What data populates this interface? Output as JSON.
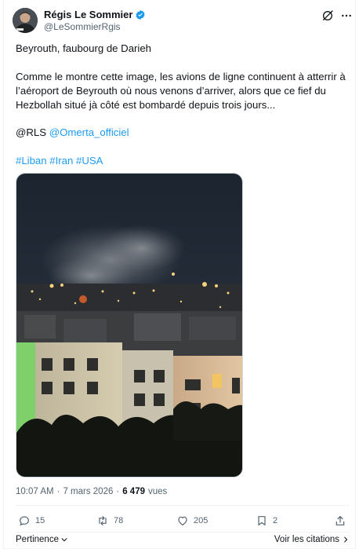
{
  "author": {
    "display_name": "Régis Le Sommier",
    "handle": "@LeSommierRgis"
  },
  "tweet": {
    "paragraph1": "Beyrouth, faubourg de Darieh",
    "paragraph2": "Comme le montre cette image, les avions de ligne continuent à atterrir à l’aéroport de Beyrouth où nous venons d’arriver, alors que ce fief du Hezbollah situé jà côté est bombardé depuis trois jours...",
    "signature_prefix": "@RLS ",
    "mention": "@Omerta_officiel",
    "hashtags": [
      "#Liban",
      "#Iran",
      "#USA"
    ]
  },
  "meta": {
    "time": "10:07 AM",
    "separator": "·",
    "date": "7 mars 2026",
    "views_count": "6 479",
    "views_label": "vues"
  },
  "actions": {
    "replies": "15",
    "retweets": "78",
    "likes": "205",
    "bookmarks": "2"
  },
  "footer": {
    "relevance": "Pertinence",
    "view_quotes": "Voir les citations"
  },
  "colors": {
    "accent": "#1d9bf0",
    "text": "#0f1419",
    "secondary": "#536471"
  }
}
